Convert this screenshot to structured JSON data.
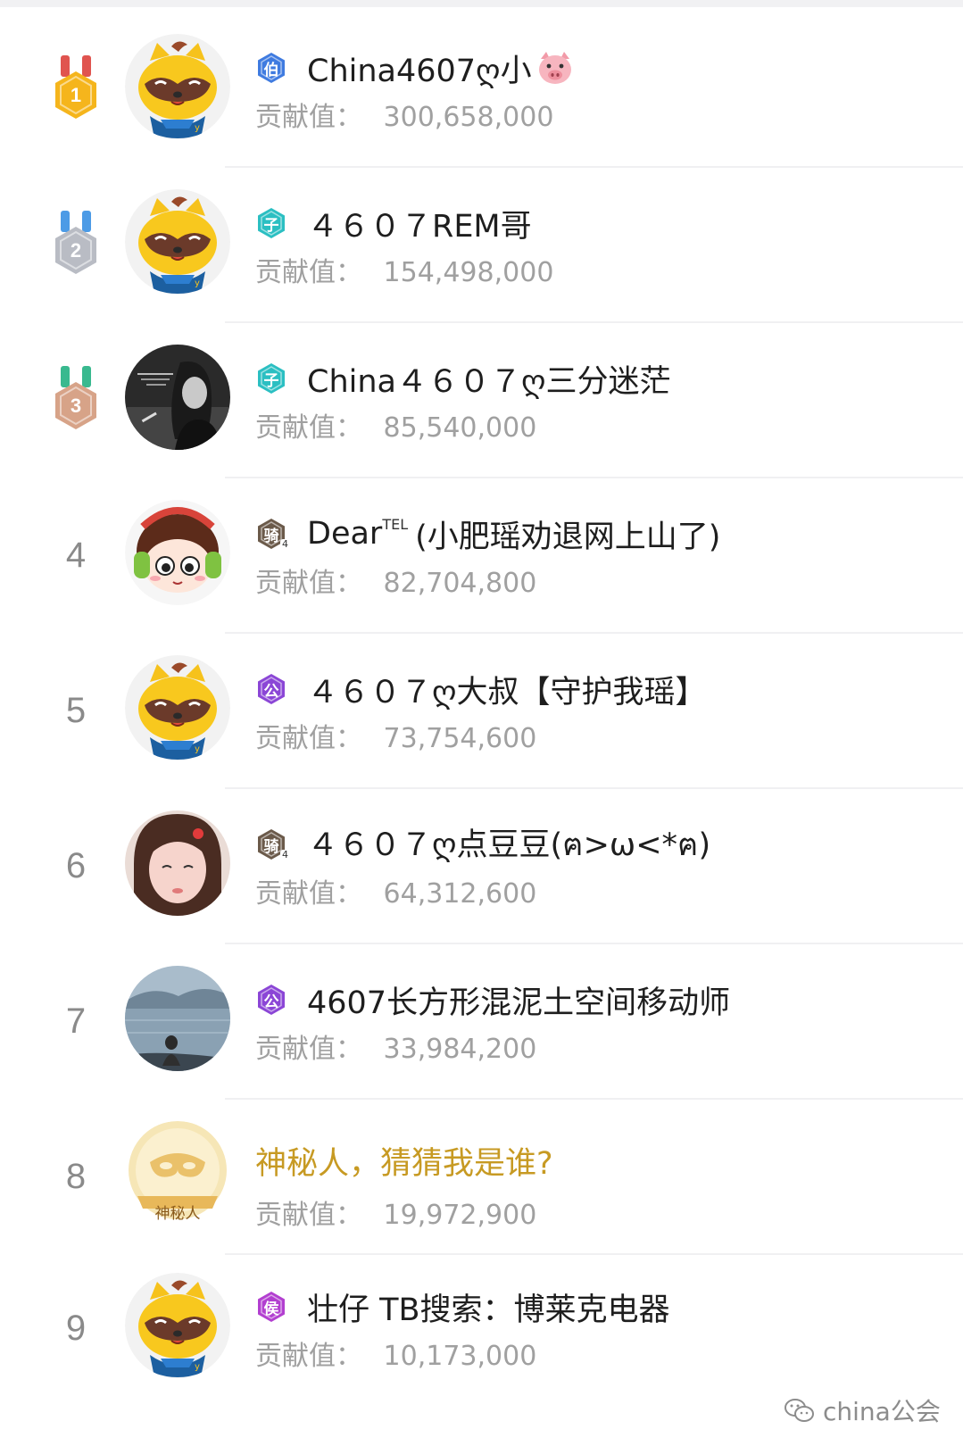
{
  "contribution_label": "贡献值：",
  "rows": [
    {
      "rank": "1",
      "badge": "伯",
      "badge_color": "#3f7be0",
      "name": "China4607ღ小",
      "emoji": "pig-face-icon",
      "value": "300,658,000",
      "avatar": "raccoon"
    },
    {
      "rank": "2",
      "badge": "子",
      "badge_color": "#2bbfc2",
      "name": "４６０７REM哥",
      "value": "154,498,000",
      "avatar": "raccoon"
    },
    {
      "rank": "3",
      "badge": "子",
      "badge_color": "#2bbfc2",
      "name": "China４６０７ღ三分迷茫",
      "value": "85,540,000",
      "avatar": "photo-woman-bw"
    },
    {
      "rank": "4",
      "badge": "骑",
      "badge_color": "#6b5a4a",
      "badge_level": "4",
      "name": "Dear",
      "name_sup": "TEL",
      "name_tail": "(小肥瑶劝退网上山了)",
      "value": "82,704,800",
      "avatar": "cartoon-headphones"
    },
    {
      "rank": "5",
      "badge": "公",
      "badge_color": "#8b46d6",
      "name": "４６０７ღ大叔【守护我瑶】",
      "value": "73,754,600",
      "avatar": "raccoon"
    },
    {
      "rank": "6",
      "badge": "骑",
      "badge_color": "#6b5a4a",
      "badge_level": "4",
      "name": "４６０７ღ点豆豆(ฅ>ω<*ฅ)",
      "value": "64,312,600",
      "avatar": "photo-girl-selfie"
    },
    {
      "rank": "7",
      "badge": "公",
      "badge_color": "#8b46d6",
      "name": "4607长方形混泥土空间移动师",
      "value": "33,984,200",
      "avatar": "photo-lake"
    },
    {
      "rank": "8",
      "badge": "",
      "badge_color": "",
      "name": "神秘人，猜猜我是谁?",
      "name_style": "gold",
      "value": "19,972,900",
      "avatar": "mystery-mask",
      "avatar_label": "神秘人"
    },
    {
      "rank": "9",
      "badge": "侯",
      "badge_color": "#b23fd0",
      "name": "壮仔 TB搜索：博莱克电器",
      "value": "10,173,000",
      "avatar": "raccoon"
    }
  ],
  "medal_colors": {
    "1": {
      "ribbon": "#e0544f",
      "body": "#f5b51c",
      "text": "#ffffff"
    },
    "2": {
      "ribbon": "#4c9be6",
      "body": "#b9bcc4",
      "text": "#ffffff"
    },
    "3": {
      "ribbon": "#39b98f",
      "body": "#d7a388",
      "text": "#ffffff"
    }
  },
  "watermark": "china公会"
}
